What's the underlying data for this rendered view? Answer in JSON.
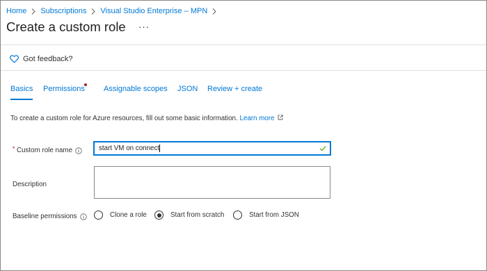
{
  "breadcrumb": {
    "items": [
      "Home",
      "Subscriptions",
      "Visual Studio Enterprise – MPN"
    ]
  },
  "page": {
    "title": "Create a custom role",
    "more_label": "···"
  },
  "feedback": {
    "label": "Got feedback?"
  },
  "tabs": [
    {
      "label": "Basics",
      "active": true
    },
    {
      "label": "Permissions",
      "required": true
    },
    {
      "label": "Assignable scopes"
    },
    {
      "label": "JSON"
    },
    {
      "label": "Review + create"
    }
  ],
  "intro": {
    "text": "To create a custom role for Azure resources, fill out some basic information.",
    "link": "Learn more"
  },
  "form": {
    "required_marker": "*",
    "role_name": {
      "label": "Custom role name",
      "value": "start VM on connect"
    },
    "description": {
      "label": "Description",
      "value": ""
    },
    "baseline": {
      "label": "Baseline permissions",
      "options": [
        "Clone a role",
        "Start from scratch",
        "Start from JSON"
      ],
      "selected": "Start from scratch"
    }
  },
  "colors": {
    "accent": "#0078d4",
    "required": "#a4262c",
    "valid": "#57a300"
  }
}
